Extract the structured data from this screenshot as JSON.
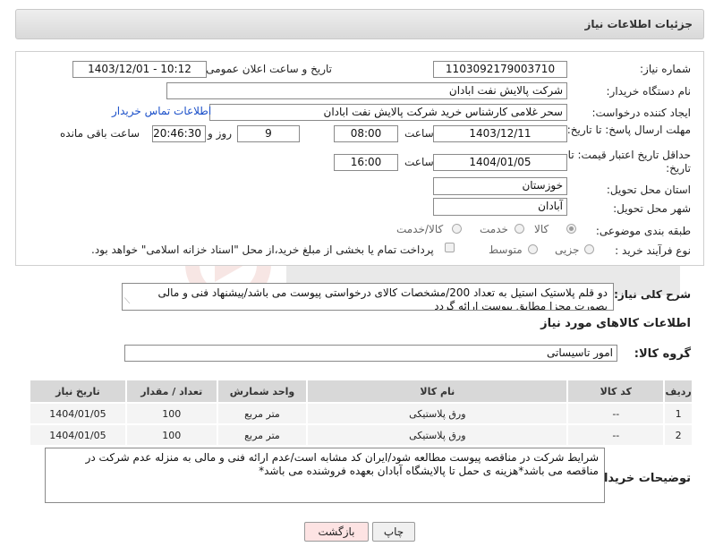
{
  "header": {
    "title": "جزئیات اطلاعات نیاز"
  },
  "form": {
    "need_number_label": "شماره نیاز:",
    "need_number": "1103092179003710",
    "announce_label": "تاریخ و ساعت اعلان عمومی:",
    "announce_value": "1403/12/01 - 10:12",
    "buyer_org_label": "نام دستگاه خریدار:",
    "buyer_org": "شرکت پالایش نفت ابادان",
    "creator_label": "ایجاد کننده درخواست:",
    "creator": "سحر غلامی کارشناس خرید  شرکت پالایش نفت ابادان",
    "contact_link": "اطلاعات تماس خریدار",
    "deadline_label": "مهلت ارسال پاسخ: تا تاریخ:",
    "deadline_date": "1403/12/11",
    "time_label": "ساعت",
    "deadline_time": "08:00",
    "days_value": "9",
    "days_label": "روز و",
    "remaining_time": "20:46:30",
    "remaining_label": "ساعت باقی مانده",
    "validity_label": "حداقل تاریخ اعتبار قیمت: تا تاریخ:",
    "validity_date": "1404/01/05",
    "validity_time_label": "ساعت",
    "validity_time": "16:00",
    "province_label": "استان محل تحویل:",
    "province": "خوزستان",
    "city_label": "شهر محل تحویل:",
    "city": "آبادان",
    "category_label": "طبقه بندی موضوعی:",
    "category_options": [
      "کالا",
      "خدمت",
      "کالا/خدمت"
    ],
    "process_label": "نوع فرآیند خرید :",
    "process_options": [
      "جزیی",
      "متوسط"
    ],
    "payment_note": "پرداخت تمام یا بخشی از مبلغ خرید،از محل \"اسناد خزانه اسلامی\" خواهد بود."
  },
  "description": {
    "label": "شرح کلی نیاز:",
    "text": "دو قلم پلاستیک استیل به تعداد 200/مشخصات کالای درخواستی پیوست می باشد/پیشنهاد فنی و مالی بصورت مجزا مطابق پیوست ارائه گردد"
  },
  "goods": {
    "section_title": "اطلاعات کالاهای مورد نیاز",
    "group_label": "گروه کالا:",
    "group_value": "امور تاسیساتی",
    "columns": [
      "ردیف",
      "کد کالا",
      "نام کالا",
      "واحد شمارش",
      "تعداد / مقدار",
      "تاریخ نیاز"
    ],
    "rows": [
      [
        "1",
        "--",
        "ورق پلاستیکی",
        "متر مربع",
        "100",
        "1404/01/05"
      ],
      [
        "2",
        "--",
        "ورق پلاستیکی",
        "متر مربع",
        "100",
        "1404/01/05"
      ]
    ]
  },
  "buyer_notes": {
    "label": "توضیحات خریدار:",
    "text": "شرایط شرکت در مناقصه پیوست مطالعه شود/ایران کد مشابه است/عدم ارائه فنی و مالی به منزله عدم شرکت در مناقصه می باشد*هزینه ی حمل تا پالایشگاه آبادان بعهده فروشنده می باشد*"
  },
  "buttons": {
    "print": "چاپ",
    "back": "بازگشت"
  },
  "colors": {
    "link": "#1a4fc9",
    "back_button_bg": "#fde3e3",
    "header_bg": "#e2e2e2"
  }
}
